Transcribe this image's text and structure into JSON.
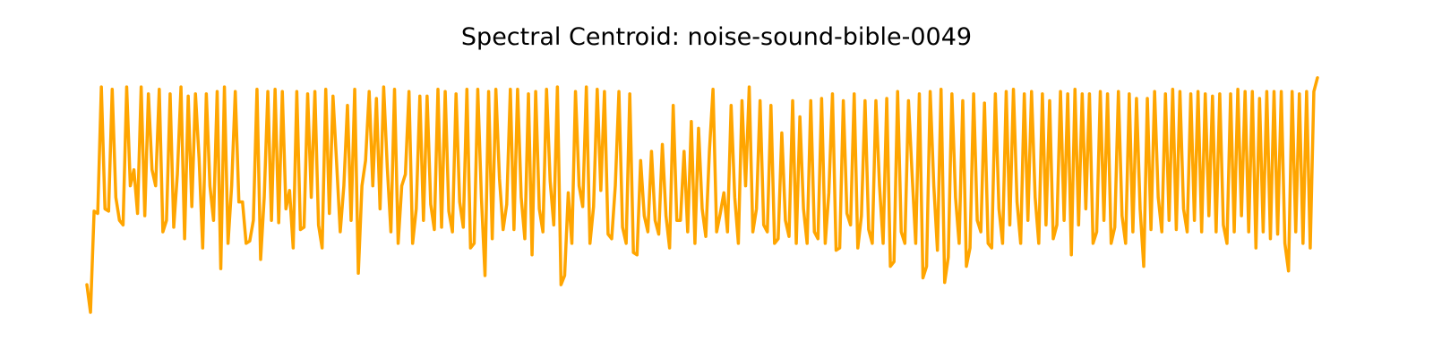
{
  "chart_data": {
    "type": "line",
    "title": "Spectral Centroid: noise-sound-bible-0049",
    "xlabel": "",
    "ylabel": "",
    "axes_visible": false,
    "grid": false,
    "legend": "none",
    "ylim": [
      0,
      1
    ],
    "series": [
      {
        "color": "#FFA500",
        "values": [
          0.12,
          0.0,
          0.44,
          0.43,
          0.98,
          0.45,
          0.44,
          0.97,
          0.5,
          0.4,
          0.38,
          0.98,
          0.55,
          0.62,
          0.43,
          0.98,
          0.42,
          0.95,
          0.62,
          0.55,
          0.97,
          0.35,
          0.4,
          0.95,
          0.37,
          0.6,
          0.98,
          0.32,
          0.94,
          0.46,
          0.95,
          0.67,
          0.28,
          0.95,
          0.55,
          0.4,
          0.96,
          0.19,
          0.98,
          0.3,
          0.55,
          0.96,
          0.48,
          0.48,
          0.3,
          0.31,
          0.4,
          0.97,
          0.23,
          0.5,
          0.96,
          0.4,
          0.97,
          0.39,
          0.96,
          0.45,
          0.53,
          0.28,
          0.96,
          0.36,
          0.37,
          0.95,
          0.5,
          0.96,
          0.38,
          0.28,
          0.97,
          0.43,
          0.94,
          0.65,
          0.35,
          0.55,
          0.9,
          0.4,
          0.97,
          0.17,
          0.55,
          0.66,
          0.96,
          0.55,
          0.93,
          0.45,
          0.98,
          0.63,
          0.35,
          0.97,
          0.3,
          0.55,
          0.6,
          0.96,
          0.3,
          0.45,
          0.94,
          0.4,
          0.94,
          0.47,
          0.36,
          0.97,
          0.37,
          0.96,
          0.44,
          0.35,
          0.95,
          0.48,
          0.37,
          0.97,
          0.28,
          0.3,
          0.97,
          0.5,
          0.16,
          0.96,
          0.32,
          0.97,
          0.58,
          0.36,
          0.47,
          0.97,
          0.36,
          0.97,
          0.5,
          0.32,
          0.95,
          0.25,
          0.96,
          0.45,
          0.35,
          0.97,
          0.57,
          0.38,
          0.98,
          0.12,
          0.16,
          0.52,
          0.3,
          0.96,
          0.55,
          0.46,
          0.98,
          0.3,
          0.46,
          0.97,
          0.53,
          0.96,
          0.34,
          0.32,
          0.55,
          0.96,
          0.37,
          0.3,
          0.95,
          0.26,
          0.25,
          0.66,
          0.42,
          0.35,
          0.7,
          0.4,
          0.34,
          0.73,
          0.42,
          0.28,
          0.9,
          0.4,
          0.4,
          0.7,
          0.35,
          0.83,
          0.3,
          0.8,
          0.45,
          0.33,
          0.7,
          0.97,
          0.35,
          0.43,
          0.52,
          0.35,
          0.9,
          0.5,
          0.3,
          0.92,
          0.55,
          0.98,
          0.35,
          0.45,
          0.92,
          0.38,
          0.35,
          0.9,
          0.3,
          0.32,
          0.78,
          0.4,
          0.33,
          0.92,
          0.3,
          0.85,
          0.45,
          0.3,
          0.92,
          0.35,
          0.32,
          0.93,
          0.3,
          0.52,
          0.95,
          0.27,
          0.28,
          0.92,
          0.43,
          0.38,
          0.95,
          0.28,
          0.42,
          0.92,
          0.36,
          0.3,
          0.92,
          0.55,
          0.3,
          0.93,
          0.2,
          0.22,
          0.96,
          0.35,
          0.3,
          0.92,
          0.6,
          0.3,
          0.95,
          0.15,
          0.2,
          0.96,
          0.55,
          0.27,
          0.97,
          0.13,
          0.24,
          0.95,
          0.5,
          0.3,
          0.92,
          0.2,
          0.28,
          0.95,
          0.4,
          0.35,
          0.91,
          0.3,
          0.28,
          0.95,
          0.45,
          0.3,
          0.96,
          0.38,
          0.97,
          0.48,
          0.3,
          0.95,
          0.4,
          0.96,
          0.5,
          0.3,
          0.95,
          0.38,
          0.92,
          0.32,
          0.38,
          0.96,
          0.4,
          0.95,
          0.25,
          0.97,
          0.38,
          0.95,
          0.45,
          0.95,
          0.3,
          0.35,
          0.96,
          0.4,
          0.95,
          0.3,
          0.37,
          0.96,
          0.42,
          0.3,
          0.95,
          0.35,
          0.93,
          0.45,
          0.2,
          0.93,
          0.36,
          0.96,
          0.5,
          0.35,
          0.95,
          0.4,
          0.97,
          0.36,
          0.96,
          0.45,
          0.35,
          0.95,
          0.4,
          0.96,
          0.35,
          0.95,
          0.42,
          0.94,
          0.35,
          0.95,
          0.38,
          0.3,
          0.95,
          0.35,
          0.97,
          0.42,
          0.96,
          0.35,
          0.96,
          0.28,
          0.93,
          0.35,
          0.96,
          0.32,
          0.96,
          0.34,
          0.96,
          0.3,
          0.18,
          0.96,
          0.35,
          0.95,
          0.3,
          0.96,
          0.28,
          0.96,
          1.02
        ]
      }
    ]
  }
}
